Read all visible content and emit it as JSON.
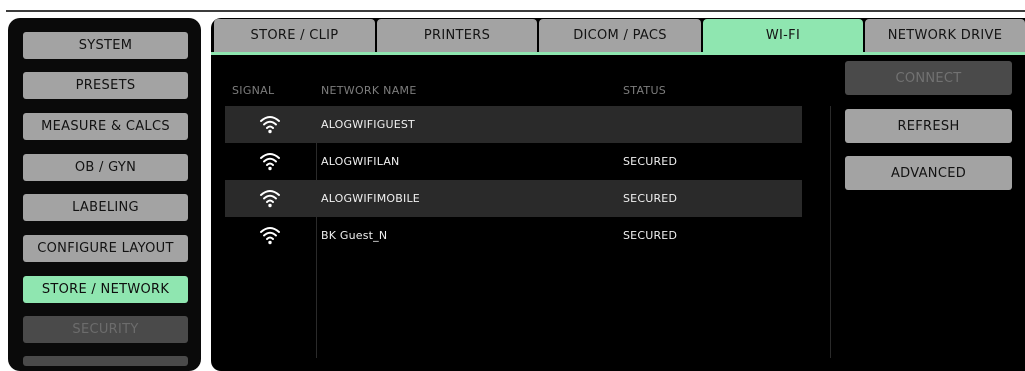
{
  "sidebar": {
    "items": [
      {
        "label": "SYSTEM",
        "state": "normal"
      },
      {
        "label": "PRESETS",
        "state": "normal"
      },
      {
        "label": "MEASURE & CALCS",
        "state": "normal"
      },
      {
        "label": "OB / GYN",
        "state": "normal"
      },
      {
        "label": "LABELING",
        "state": "normal"
      },
      {
        "label": "CONFIGURE LAYOUT",
        "state": "normal"
      },
      {
        "label": "STORE / NETWORK",
        "state": "active"
      },
      {
        "label": "SECURITY",
        "state": "disabled"
      }
    ]
  },
  "tabs": [
    {
      "label": "STORE / CLIP",
      "active": false
    },
    {
      "label": "PRINTERS",
      "active": false
    },
    {
      "label": "DICOM / PACS",
      "active": false
    },
    {
      "label": "WI-FI",
      "active": true
    },
    {
      "label": "NETWORK DRIVE",
      "active": false
    }
  ],
  "table": {
    "headers": {
      "signal": "SIGNAL",
      "name": "NETWORK NAME",
      "status": "STATUS"
    },
    "rows": [
      {
        "signal_icon": "wifi-full-icon",
        "name": "ALOGWIFIGUEST",
        "status": ""
      },
      {
        "signal_icon": "wifi-full-icon",
        "name": "ALOGWIFILAN",
        "status": "SECURED"
      },
      {
        "signal_icon": "wifi-full-icon",
        "name": "ALOGWIFIMOBILE",
        "status": "SECURED"
      },
      {
        "signal_icon": "wifi-full-icon",
        "name": "BK Guest_N",
        "status": "SECURED"
      }
    ]
  },
  "actions": {
    "connect": "CONNECT",
    "refresh": "REFRESH",
    "advanced": "ADVANCED"
  },
  "colors": {
    "accent": "#8fe6b0",
    "button": "#a3a3a3",
    "disabled": "#4a4a4a",
    "row_shade": "#2a2a2a",
    "background": "#000000"
  }
}
